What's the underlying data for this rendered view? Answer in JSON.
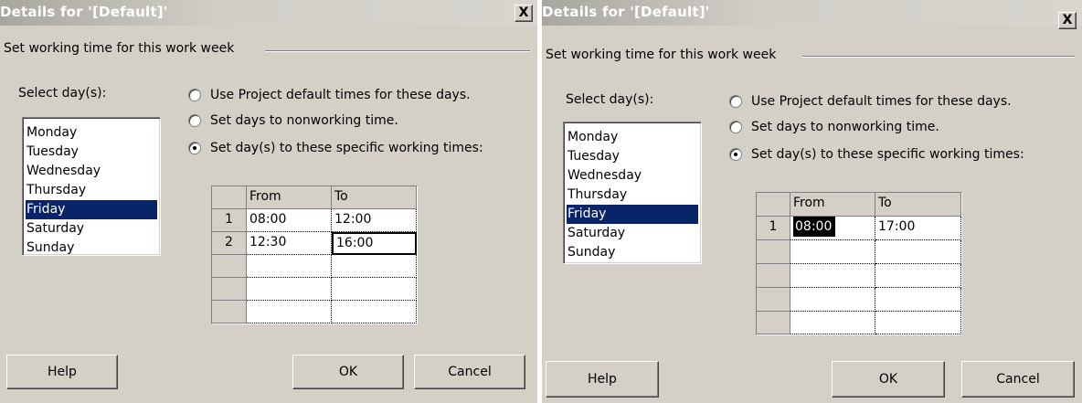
{
  "dialogs": [
    {
      "title": "Details for '[Default]'",
      "close_glyph": "X",
      "group_label": "Set working time for this work week",
      "select_days_label": "Select day(s):",
      "days": [
        "Monday",
        "Tuesday",
        "Wednesday",
        "Thursday",
        "Friday",
        "Saturday",
        "Sunday"
      ],
      "selected_day": "Friday",
      "radios": [
        {
          "label": "Use Project default times for these days.",
          "checked": false
        },
        {
          "label": "Set days to nonworking time.",
          "checked": false
        },
        {
          "label": "Set day(s) to these specific working times:",
          "checked": true
        }
      ],
      "grid": {
        "col_from": "From",
        "col_to": "To",
        "rows": [
          {
            "n": "1",
            "from": "08:00",
            "to": "12:00"
          },
          {
            "n": "2",
            "from": "12:30",
            "to": "16:00"
          },
          {
            "n": "",
            "from": "",
            "to": ""
          },
          {
            "n": "",
            "from": "",
            "to": ""
          },
          {
            "n": "",
            "from": "",
            "to": ""
          }
        ]
      },
      "buttons": {
        "help": "Help",
        "ok": "OK",
        "cancel": "Cancel"
      }
    },
    {
      "title": "Details for '[Default]'",
      "close_glyph": "X",
      "group_label": "Set working time for this work week",
      "select_days_label": "Select day(s):",
      "days": [
        "Monday",
        "Tuesday",
        "Wednesday",
        "Thursday",
        "Friday",
        "Saturday",
        "Sunday"
      ],
      "selected_day": "Friday",
      "radios": [
        {
          "label": "Use Project default times for these days.",
          "checked": false
        },
        {
          "label": "Set days to nonworking time.",
          "checked": false
        },
        {
          "label": "Set day(s) to these specific working times:",
          "checked": true
        }
      ],
      "grid": {
        "col_from": "From",
        "col_to": "To",
        "rows": [
          {
            "n": "1",
            "from": "08:00",
            "to": "17:00"
          },
          {
            "n": "",
            "from": "",
            "to": ""
          },
          {
            "n": "",
            "from": "",
            "to": ""
          },
          {
            "n": "",
            "from": "",
            "to": ""
          },
          {
            "n": "",
            "from": "",
            "to": ""
          }
        ]
      },
      "buttons": {
        "help": "Help",
        "ok": "OK",
        "cancel": "Cancel"
      }
    }
  ],
  "colors": {
    "dialog_face": "#d4d0c8",
    "selection": "#0a246a",
    "title_text": "#ffffff"
  }
}
